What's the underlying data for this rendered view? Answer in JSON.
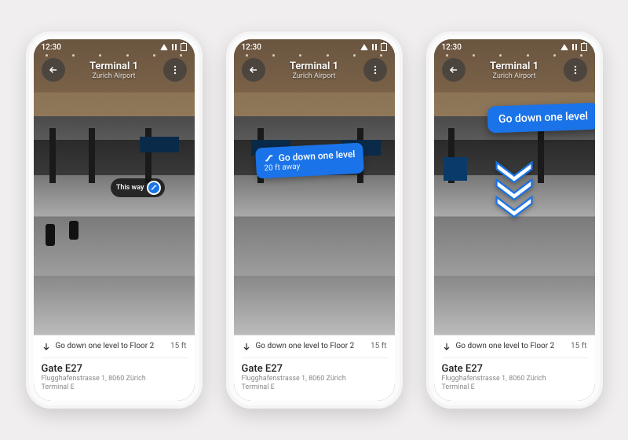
{
  "statusbar": {
    "time": "12:30"
  },
  "header": {
    "title": "Terminal 1",
    "subtitle": "Zurich Airport"
  },
  "step": {
    "text": "Go down one level to Floor 2",
    "distance": "15 ft"
  },
  "destination": {
    "name": "Gate E27",
    "address": "Flugghafenstrasse 1, 8060 Zürich",
    "terminal": "Terminal E"
  },
  "ar_overlays": {
    "phone1": {
      "label": "This way"
    },
    "phone2": {
      "title": "Go down one level",
      "distance": "20 ft away"
    },
    "phone3": {
      "title": "Go down one level"
    }
  },
  "colors": {
    "accent": "#1a73e8"
  }
}
